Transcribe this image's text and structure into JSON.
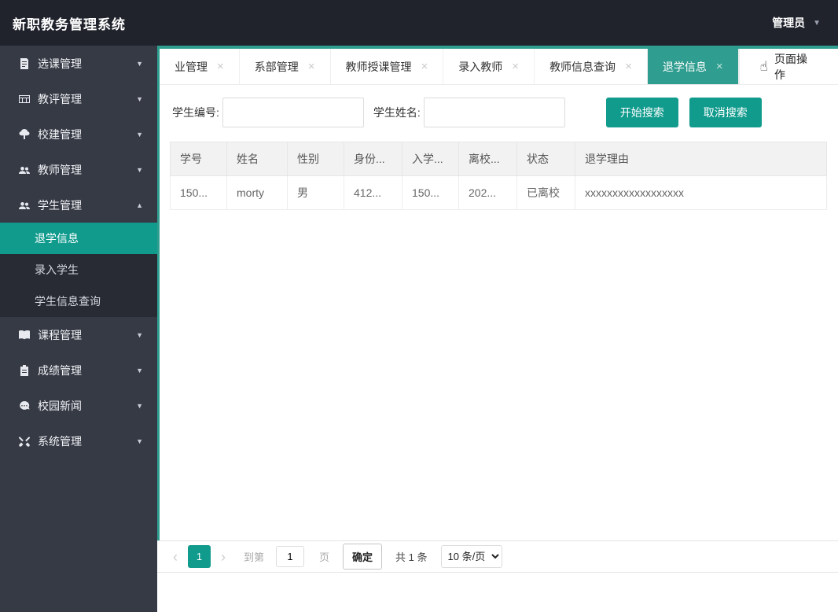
{
  "header": {
    "title": "新职教务管理系统",
    "user_menu": {
      "label": "管理员"
    }
  },
  "icons": {
    "close": "×",
    "hand": "☝",
    "caret_down": "▼",
    "caret_up": "▲",
    "prev": "‹",
    "next": "›"
  },
  "sidebar": {
    "items": [
      {
        "label": "选课管理"
      },
      {
        "label": "教评管理"
      },
      {
        "label": "校建管理"
      },
      {
        "label": "教师管理"
      },
      {
        "label": "学生管理"
      },
      {
        "label": "课程管理"
      },
      {
        "label": "成绩管理"
      },
      {
        "label": "校园新闻"
      },
      {
        "label": "系统管理"
      }
    ],
    "submenu": [
      {
        "label": "退学信息",
        "active": true
      },
      {
        "label": "录入学生"
      },
      {
        "label": "学生信息查询"
      }
    ]
  },
  "tabs": {
    "items": [
      {
        "label": "业管理"
      },
      {
        "label": "系部管理"
      },
      {
        "label": "教师授课管理"
      },
      {
        "label": "录入教师"
      },
      {
        "label": "教师信息查询"
      },
      {
        "label": "退学信息",
        "active": true
      }
    ],
    "page_ops": "页面操作"
  },
  "search": {
    "id_label": "学生编号:",
    "id_value": "",
    "name_label": "学生姓名:",
    "name_value": "",
    "start_button": "开始搜索",
    "cancel_button": "取消搜索"
  },
  "table": {
    "headers": [
      "学号",
      "姓名",
      "性别",
      "身份...",
      "入学...",
      "离校...",
      "状态",
      "退学理由"
    ],
    "rows": [
      [
        "150...",
        "morty",
        "男",
        "412...",
        "150...",
        "202...",
        "已离校",
        "xxxxxxxxxxxxxxxxxx"
      ]
    ]
  },
  "pagination": {
    "current_page": "1",
    "goto_label": "到第",
    "goto_value": "1",
    "page_label": "页",
    "confirm_button": "确定",
    "total_text": "共 1 条",
    "page_size_option": "10 条/页"
  },
  "colors": {
    "accent_teal": "#119b8d",
    "tab_active_teal": "#2f9d8f",
    "header_bg": "#20232c",
    "sidebar_bg": "#363a45",
    "submenu_bg": "#282b34",
    "table_header_bg": "#f2f2f2"
  }
}
